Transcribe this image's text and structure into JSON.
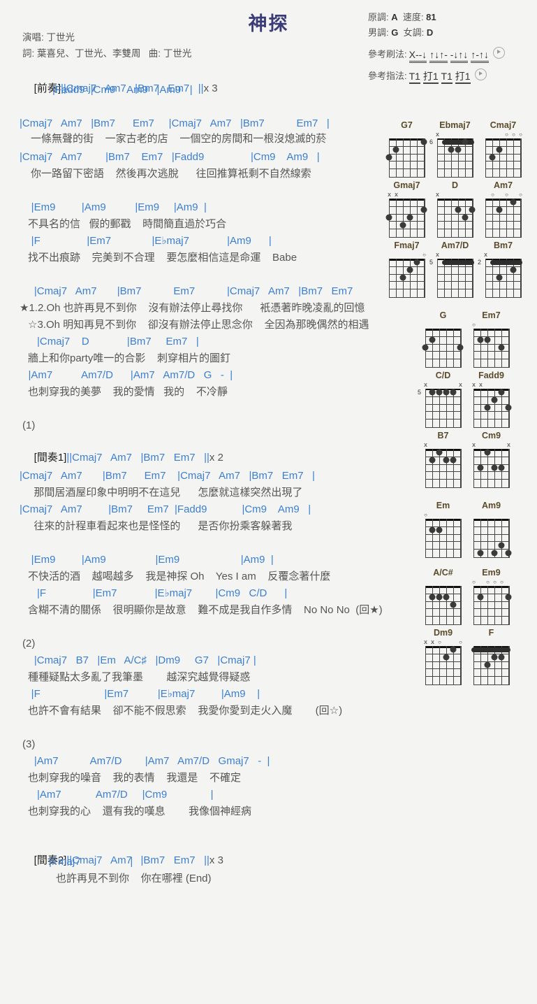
{
  "header": {
    "title": "神探",
    "singer_label": "演唱:",
    "singer": "丁世光",
    "lyricist_label": "詞:",
    "lyricist": "葉喜兒、丁世光、李雙周",
    "composer_label": "曲:",
    "composer": "丁世光",
    "orig_key_label": "原調:",
    "orig_key": "A",
    "tempo_label": "速度:",
    "tempo": "81",
    "male_key_label": "男調:",
    "male_key": "G",
    "female_key_label": "女調:",
    "female_key": "D",
    "strum_label": "參考刷法:",
    "strum_pattern": "X--↓ ↑↓↑- -↓↑↓ ↑-↑↓",
    "fingerstyle_label": "參考指法:",
    "fingerstyle_pattern": "T1 打1 T1 打1",
    "play_icon": "play-icon"
  },
  "sheet": {
    "intro": {
      "tag": "[前奏]",
      "line1": "||Cmaj7   Am7   |Bm7   Em7   ||",
      "times1": "x 3",
      "line2": "|Fadd9  |Cm9    Am9   |Am9   |"
    },
    "verse1": {
      "chord1": "|Cmaj7   Am7   |Bm7      Em7     |Cmaj7   Am7   |Bm7           Em7   |",
      "lyric1": "一條無聲的街    一家古老的店    一個空的房間和一根沒熄滅的菸",
      "chord2": "|Cmaj7   Am7        |Bm7    Em7   |Fadd9                |Cm9    Am9   |",
      "lyric2": "你一路留下密語    然後再次逃脫      往回推算衹剩不自然線索"
    },
    "verse1b": {
      "chord1": "    |Em9         |Am9          |Em9     |Am9  |",
      "lyric1": "不具名的信   假的郵戳    時間簡直過於巧合",
      "chord2": "    |F                |Em7              |E♭maj7             |Am9      |",
      "lyric2": "找不出痕跡    完美到不合理    要怎麼相信這是命運    Babe"
    },
    "chorus": {
      "chord1": "     |Cmaj7   Am7       |Bm7           Em7           |Cmaj7   Am7   |Bm7   Em7",
      "lyric1": "★1.2.Oh 也許再見不到你    沒有辦法停止尋找你      衹憑著昨晚凌亂的回憶",
      "lyric2": "☆3.Oh 明知再見不到你    卻沒有辦法停止思念你    全因為那晚偶然的相遇",
      "chord2": "      |Cmaj7    D             |Bm7     Em7   |",
      "lyric3": "牆上和你party唯一的合影    刺穿相片的圖釘",
      "chord3": "   |Am7          Am7/D      |Am7   Am7/D   G   -  |",
      "lyric4": "也刺穿我的美夢    我的愛情   我的    不冷靜"
    },
    "section1_num": "(1)",
    "interlude1": {
      "tag": "[間奏1]",
      "line": "||Cmaj7   Am7   |Bm7   Em7   ||",
      "times": "x 2"
    },
    "verse2": {
      "chord1": "|Cmaj7   Am7       |Bm7      Em7    |Cmaj7   Am7   |Bm7   Em7   |",
      "lyric1": "  那間居酒屋印象中明明不在這兒      怎麼就這樣突然出現了",
      "chord2": "|Cmaj7   Am7         |Bm7     Em7  |Fadd9            |Cm9    Am9   |",
      "lyric2": "  往來的計程車看起來也是怪怪的      是否你扮乘客躲著我"
    },
    "verse2b": {
      "chord1": "    |Em9         |Am9                 |Em9                     |Am9  |",
      "lyric1": "不快活的酒    越喝越多    我是神探 Oh    Yes I am    反覆念著什麼",
      "chord2": "      |F                |Em7             |E♭maj7        |Cm9   C/D      |",
      "lyric2": "含糊不清的關係    很明顯你是故意    難不成是我自作多情    No No No  (回★)"
    },
    "section2_num": "(2)",
    "verse3": {
      "chord1": "     |Cmaj7   B7   |Em   A/C♯   |Dm9     G7   |Cmaj7 |",
      "lyric1": "種種疑點太多亂了我筆墨        越深究越覺得疑惑",
      "chord2": "    |F                      |Em7          |E♭maj7         |Am9    |",
      "lyric2": "也許不會有結果    卻不能不假思索    我愛你愛到走火入魔        (回☆)"
    },
    "section3_num": "(3)",
    "bridge": {
      "chord1": "     |Am7           Am7/D        |Am7   Am7/D   Gmaj7   -  |",
      "lyric1": "也刺穿我的噪音    我的表情    我還是    不確定",
      "chord2": "      |Am7            Am7/D     |Cm9               |",
      "lyric2": "也刺穿我的心    還有我的嘆息        我像個神經病"
    },
    "interlude2": {
      "tag": "[間奏2]",
      "line": "||Cmaj7   Am7   |Bm7   Em7   ||",
      "times": "x 3",
      "line2": "|Fmaj7                 |",
      "lyric": "也許再見不到你    你在哪裡 (End)"
    }
  },
  "chord_diagrams": [
    {
      "name": "G7",
      "markers": [
        "",
        "",
        "",
        "",
        "",
        ""
      ],
      "base": 1,
      "dots": [
        {
          "s": 6,
          "f": 3
        },
        {
          "s": 5,
          "f": 2
        },
        {
          "s": 1,
          "f": 1
        }
      ],
      "barre": null
    },
    {
      "name": "Ebmaj7",
      "markers": [
        "x",
        "",
        "",
        "",
        "",
        ""
      ],
      "base": 6,
      "dots": [
        {
          "s": 4,
          "f": 2
        },
        {
          "s": 3,
          "f": 2
        },
        {
          "s": 2,
          "f": 1
        }
      ],
      "barre": {
        "from": 5,
        "to": 1,
        "f": 1
      }
    },
    {
      "name": "Cmaj7",
      "markers": [
        "",
        "",
        "",
        "o",
        "o",
        "o"
      ],
      "base": 1,
      "dots": [
        {
          "s": 5,
          "f": 3
        },
        {
          "s": 4,
          "f": 2
        }
      ],
      "barre": null
    },
    {
      "name": "Gmaj7",
      "markers": [
        "x",
        "x",
        "",
        "",
        "",
        ""
      ],
      "base": 1,
      "dots": [
        {
          "s": 6,
          "f": 3
        },
        {
          "s": 4,
          "f": 4
        },
        {
          "s": 3,
          "f": 3
        },
        {
          "s": 1,
          "f": 2
        }
      ],
      "barre": null
    },
    {
      "name": "D",
      "markers": [
        "x",
        "",
        "",
        "",
        "",
        ""
      ],
      "base": 1,
      "dots": [
        {
          "s": 3,
          "f": 2
        },
        {
          "s": 2,
          "f": 3
        },
        {
          "s": 1,
          "f": 2
        }
      ],
      "barre": null
    },
    {
      "name": "Am7",
      "markers": [
        "",
        "o",
        "",
        "o",
        "",
        "o"
      ],
      "base": 1,
      "dots": [
        {
          "s": 4,
          "f": 2
        },
        {
          "s": 2,
          "f": 1
        }
      ],
      "barre": null
    },
    {
      "name": "Fmaj7",
      "markers": [
        "",
        "",
        "",
        "",
        "",
        "o"
      ],
      "base": 1,
      "dots": [
        {
          "s": 4,
          "f": 3
        },
        {
          "s": 3,
          "f": 2
        },
        {
          "s": 2,
          "f": 1
        }
      ],
      "barre": null
    },
    {
      "name": "Am7/D",
      "markers": [
        "x",
        "",
        "",
        "",
        "",
        ""
      ],
      "base": 5,
      "dots": [],
      "barre": {
        "from": 5,
        "to": 1,
        "f": 1
      }
    },
    {
      "name": "Bm7",
      "markers": [
        "x",
        "",
        "",
        "",
        "",
        ""
      ],
      "base": 2,
      "dots": [
        {
          "s": 4,
          "f": 3
        },
        {
          "s": 2,
          "f": 2
        }
      ],
      "barre": {
        "from": 5,
        "to": 1,
        "f": 1
      }
    },
    {
      "name": "G",
      "markers": [
        "",
        "",
        "",
        "",
        "",
        ""
      ],
      "base": 1,
      "dots": [
        {
          "s": 6,
          "f": 3
        },
        {
          "s": 5,
          "f": 2
        },
        {
          "s": 1,
          "f": 3
        }
      ],
      "barre": null
    },
    {
      "name": "Em7",
      "markers": [
        "o",
        "",
        "",
        "",
        "",
        ""
      ],
      "base": 1,
      "dots": [
        {
          "s": 5,
          "f": 2
        },
        {
          "s": 4,
          "f": 2
        },
        {
          "s": 2,
          "f": 3
        }
      ],
      "barre": null
    },
    {
      "name": "C/D",
      "markers": [
        "x",
        "",
        "",
        "",
        "",
        "x"
      ],
      "base": 5,
      "dots": [
        {
          "s": 5,
          "f": 1
        },
        {
          "s": 4,
          "f": 1
        },
        {
          "s": 3,
          "f": 1
        },
        {
          "s": 2,
          "f": 1
        }
      ],
      "barre": null
    },
    {
      "name": "Fadd9",
      "markers": [
        "x",
        "x",
        "",
        "",
        "",
        ""
      ],
      "base": 1,
      "dots": [
        {
          "s": 4,
          "f": 3
        },
        {
          "s": 3,
          "f": 2
        },
        {
          "s": 2,
          "f": 1
        },
        {
          "s": 1,
          "f": 3
        }
      ],
      "barre": null
    },
    {
      "name": "B7",
      "markers": [
        "x",
        "",
        "",
        "",
        "",
        ""
      ],
      "base": 1,
      "dots": [
        {
          "s": 5,
          "f": 2
        },
        {
          "s": 4,
          "f": 1
        },
        {
          "s": 3,
          "f": 2
        },
        {
          "s": 2,
          "f": 2
        }
      ],
      "barre": null
    },
    {
      "name": "Cm9",
      "markers": [
        "x",
        "",
        "",
        "",
        "",
        "x"
      ],
      "base": 1,
      "dots": [
        {
          "s": 5,
          "f": 3
        },
        {
          "s": 4,
          "f": 1
        },
        {
          "s": 3,
          "f": 3
        },
        {
          "s": 2,
          "f": 3
        }
      ],
      "barre": null
    },
    {
      "name": "Em",
      "markers": [
        "o",
        "",
        "",
        "",
        "",
        ""
      ],
      "base": 1,
      "dots": [
        {
          "s": 5,
          "f": 2
        },
        {
          "s": 4,
          "f": 2
        }
      ],
      "barre": null
    },
    {
      "name": "Am9",
      "markers": [
        "",
        "",
        "",
        "",
        "",
        ""
      ],
      "base": 1,
      "dots": [
        {
          "s": 5,
          "f": 5
        },
        {
          "s": 3,
          "f": 5
        },
        {
          "s": 2,
          "f": 4
        },
        {
          "s": 1,
          "f": 5
        }
      ],
      "barre": null
    },
    {
      "name": "A/C#",
      "markers": [
        "",
        "",
        "",
        "",
        "",
        ""
      ],
      "base": 1,
      "dots": [
        {
          "s": 5,
          "f": 2
        },
        {
          "s": 4,
          "f": 2
        },
        {
          "s": 3,
          "f": 2
        },
        {
          "s": 2,
          "f": 3
        }
      ],
      "barre": null
    },
    {
      "name": "Em9",
      "markers": [
        "o",
        "",
        "o",
        "o",
        "o",
        ""
      ],
      "base": 1,
      "dots": [
        {
          "s": 5,
          "f": 2
        },
        {
          "s": 1,
          "f": 2
        }
      ],
      "barre": null
    },
    {
      "name": "Dm9",
      "markers": [
        "x",
        "x",
        "o",
        "",
        "",
        "o"
      ],
      "base": 1,
      "dots": [
        {
          "s": 3,
          "f": 2
        },
        {
          "s": 2,
          "f": 1
        }
      ],
      "barre": null
    },
    {
      "name": "F",
      "markers": [
        "",
        "",
        "",
        "",
        "",
        ""
      ],
      "base": 1,
      "dots": [
        {
          "s": 4,
          "f": 3
        },
        {
          "s": 3,
          "f": 2
        },
        {
          "s": 2,
          "f": 2
        }
      ],
      "barre": {
        "from": 6,
        "to": 1,
        "f": 1
      }
    }
  ]
}
